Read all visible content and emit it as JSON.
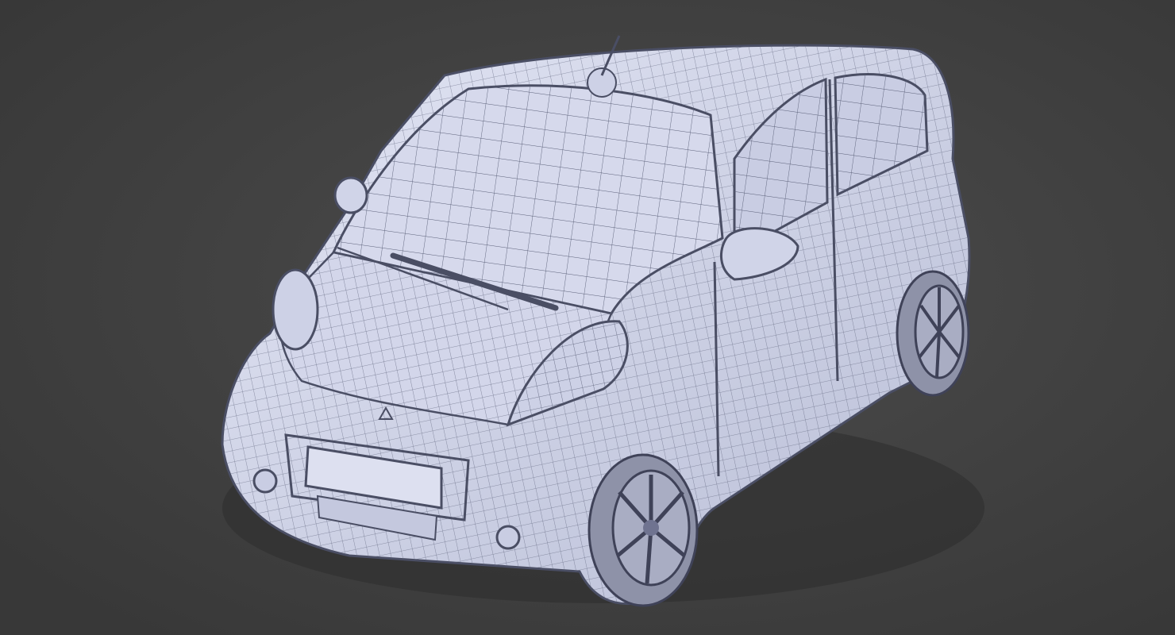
{
  "scene": {
    "subject": "wireframe-car-render",
    "colors": {
      "background": "#404040",
      "background_light": "#4b4b4b",
      "body": "#d9dcee",
      "body_shade": "#b8bdd6",
      "wire": "#5a5f78",
      "glass": "#c9cde3",
      "tire": "#8e92a8"
    }
  }
}
